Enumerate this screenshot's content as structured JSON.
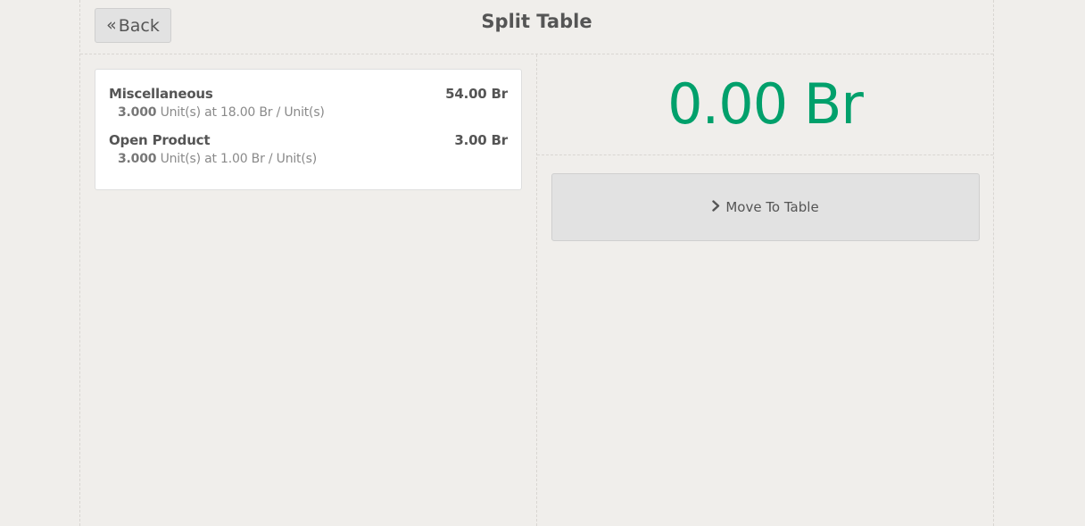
{
  "header": {
    "back_icon": "«",
    "back_label": "Back",
    "title": "Split Table"
  },
  "orderlines": [
    {
      "product": "Miscellaneous",
      "price": "54.00 Br",
      "quantity": "3.000",
      "detail": "Unit(s) at 18.00 Br / Unit(s)"
    },
    {
      "product": "Open Product",
      "price": "3.00 Br",
      "quantity": "3.000",
      "detail": "Unit(s) at 1.00 Br / Unit(s)"
    }
  ],
  "total": {
    "amount": "0.00 Br",
    "color": "#00a06b"
  },
  "actions": {
    "move_icon": "chevron-right-icon",
    "move_label": "Move To Table"
  }
}
